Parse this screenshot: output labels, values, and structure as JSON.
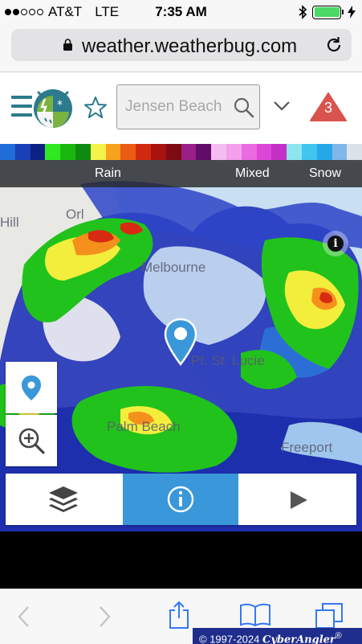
{
  "status_bar": {
    "carrier": "AT&T",
    "network": "LTE",
    "time": "7:35 AM"
  },
  "browser": {
    "url": "weather.weatherbug.com"
  },
  "header": {
    "search_placeholder": "Jensen Beach",
    "alert_count": "3",
    "alert_color": "#d9534f",
    "brand_color": "#2d7a8c"
  },
  "color_scale": [
    "#1f6dd8",
    "#1b3fb5",
    "#0b2183",
    "#2fe81f",
    "#19b811",
    "#0f8a11",
    "#f5f24a",
    "#f6a21c",
    "#ec5b14",
    "#d12a12",
    "#a8120f",
    "#7e0b12",
    "#9a1f88",
    "#610c66",
    "#f5bcf1",
    "#f59ee9",
    "#eb6ae0",
    "#dd46d6",
    "#c42fc6",
    "#8de5f0",
    "#41c6ee",
    "#27a8ea",
    "#7fb7e8",
    "#dce3e8"
  ],
  "legend": {
    "rain": "Rain",
    "mixed": "Mixed",
    "snow": "Snow"
  },
  "map": {
    "labels": {
      "hill": "Hill",
      "orlando": "Orl",
      "melbourne": "Melbourne",
      "st_lucie": "Pt. St. Lucie",
      "palm_beach": "Palm Beach",
      "freeport": "Freeport"
    }
  },
  "controls": {
    "accent_color": "#3a97d9"
  },
  "footer": {
    "copyright": "© 1997-2024",
    "brand": "CyberAngler",
    "mark": "®"
  }
}
